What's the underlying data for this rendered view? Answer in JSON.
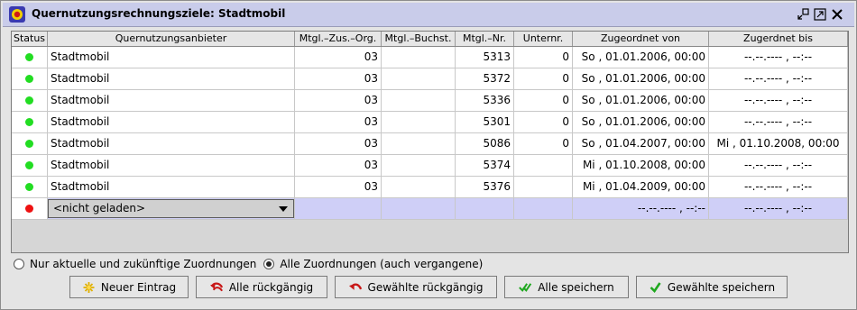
{
  "window": {
    "title": "Quernutzungsrechnungsziele: Stadtmobil"
  },
  "columns": [
    "Status",
    "Quernutzungsanbieter",
    "Mtgl.–Zus.–Org.",
    "Mtgl.–Buchst.",
    "Mtgl.–Nr.",
    "Unternr.",
    "Zugeordnet von",
    "Zugerdnet bis"
  ],
  "rows": [
    {
      "status": "green",
      "anbieter": "Stadtmobil",
      "org": "03",
      "buchst": "",
      "nr": "5313",
      "unternr": "0",
      "von": "So , 01.01.2006, 00:00",
      "bis": "--.--.---- , --:--"
    },
    {
      "status": "green",
      "anbieter": "Stadtmobil",
      "org": "03",
      "buchst": "",
      "nr": "5372",
      "unternr": "0",
      "von": "So , 01.01.2006, 00:00",
      "bis": "--.--.---- , --:--"
    },
    {
      "status": "green",
      "anbieter": "Stadtmobil",
      "org": "03",
      "buchst": "",
      "nr": "5336",
      "unternr": "0",
      "von": "So , 01.01.2006, 00:00",
      "bis": "--.--.---- , --:--"
    },
    {
      "status": "green",
      "anbieter": "Stadtmobil",
      "org": "03",
      "buchst": "",
      "nr": "5301",
      "unternr": "0",
      "von": "So , 01.01.2006, 00:00",
      "bis": "--.--.---- , --:--"
    },
    {
      "status": "green",
      "anbieter": "Stadtmobil",
      "org": "03",
      "buchst": "",
      "nr": "5086",
      "unternr": "0",
      "von": "So , 01.04.2007, 00:00",
      "bis": "Mi , 01.10.2008, 00:00"
    },
    {
      "status": "green",
      "anbieter": "Stadtmobil",
      "org": "03",
      "buchst": "",
      "nr": "5374",
      "unternr": "",
      "von": "Mi , 01.10.2008, 00:00",
      "bis": "--.--.---- , --:--"
    },
    {
      "status": "green",
      "anbieter": "Stadtmobil",
      "org": "03",
      "buchst": "",
      "nr": "5376",
      "unternr": "",
      "von": "Mi , 01.04.2009, 00:00",
      "bis": "--.--.---- , --:--"
    }
  ],
  "new_row": {
    "status": "red",
    "select_value": "<nicht geladen>",
    "von": "--.--.---- , --:--",
    "bis": "--.--.---- , --:--"
  },
  "filter": {
    "option_current": "Nur aktuelle und zukünftige Zuordnungen",
    "option_all": "Alle Zuordnungen (auch vergangene)",
    "selected": "all"
  },
  "buttons": {
    "new_entry": "Neuer Eintrag",
    "undo_all": "Alle rückgängig",
    "undo_selected": "Gewählte rückgängig",
    "save_all": "Alle speichern",
    "save_selected": "Gewählte speichern"
  },
  "colors": {
    "status_green": "#22dd22",
    "status_red": "#ee1111",
    "title_bg": "#c9ccea",
    "selected_row": "#cfcff7"
  }
}
